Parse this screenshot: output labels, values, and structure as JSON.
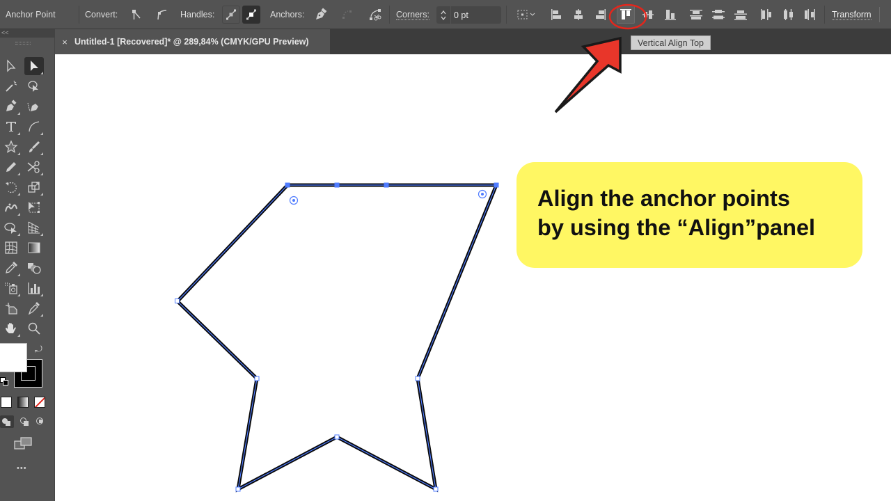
{
  "control_bar": {
    "tool_name": "Anchor Point",
    "convert_label": "Convert:",
    "convert_buttons": [
      {
        "icon": "convert-to-corner-icon",
        "tooltip": "Convert selected anchor points to corner"
      },
      {
        "icon": "convert-to-smooth-icon",
        "tooltip": "Convert selected anchor points to smooth"
      }
    ],
    "handles_label": "Handles:",
    "handles_buttons": [
      {
        "icon": "show-handles-icon",
        "selected": false
      },
      {
        "icon": "hide-handles-icon",
        "selected": true
      }
    ],
    "anchors_label": "Anchors:",
    "anchors_buttons": [
      {
        "icon": "remove-anchor-pen-icon",
        "enabled": true
      },
      {
        "icon": "connect-endpoints-icon",
        "enabled": false
      },
      {
        "icon": "cut-path-at-anchor-icon",
        "enabled": true
      }
    ],
    "corners_label": "Corners:",
    "corners_value": "0 pt",
    "align_to_icon": "align-to-selection-icon",
    "align_buttons": [
      {
        "icon": "horizontal-align-left-icon",
        "tooltip": "Horizontal Align Left"
      },
      {
        "icon": "horizontal-align-center-icon",
        "tooltip": "Horizontal Align Center"
      },
      {
        "icon": "horizontal-align-right-icon",
        "tooltip": "Horizontal Align Right"
      },
      {
        "icon": "vertical-align-top-icon",
        "tooltip": "Vertical Align Top",
        "hovered": true
      },
      {
        "icon": "vertical-align-center-icon",
        "tooltip": "Vertical Align Center"
      },
      {
        "icon": "vertical-align-bottom-icon",
        "tooltip": "Vertical Align Bottom"
      }
    ],
    "distribute_buttons": [
      {
        "icon": "vertical-distribute-top-icon"
      },
      {
        "icon": "vertical-distribute-center-icon"
      },
      {
        "icon": "vertical-distribute-bottom-icon"
      },
      {
        "icon": "horizontal-distribute-left-icon"
      },
      {
        "icon": "horizontal-distribute-center-icon"
      },
      {
        "icon": "horizontal-distribute-right-icon"
      }
    ],
    "transform_label": "Transform"
  },
  "tooltip": {
    "text": "Vertical Align Top"
  },
  "document_tab": {
    "close_glyph": "×",
    "title": "Untitled-1 [Recovered]* @ 289,84% (CMYK/GPU Preview)"
  },
  "toolbar": {
    "collapse_glyph": "<<",
    "tools": [
      {
        "name": "selection-tool",
        "active": false
      },
      {
        "name": "direct-selection-tool",
        "active": true
      },
      {
        "name": "magic-wand-tool"
      },
      {
        "name": "lasso-tool"
      },
      {
        "name": "pen-tool"
      },
      {
        "name": "curvature-pen-tool"
      },
      {
        "name": "type-tool"
      },
      {
        "name": "arc-tool"
      },
      {
        "name": "star-tool"
      },
      {
        "name": "paintbrush-tool"
      },
      {
        "name": "pencil-tool"
      },
      {
        "name": "scissors-tool"
      },
      {
        "name": "rotate-tool"
      },
      {
        "name": "scale-tool"
      },
      {
        "name": "puppet-warp-tool"
      },
      {
        "name": "free-transform-tool"
      },
      {
        "name": "shape-builder-tool"
      },
      {
        "name": "perspective-grid-tool"
      },
      {
        "name": "mesh-tool"
      },
      {
        "name": "gradient-tool"
      },
      {
        "name": "eyedropper-tool"
      },
      {
        "name": "blend-tool"
      },
      {
        "name": "symbol-sprayer-tool"
      },
      {
        "name": "column-graph-tool"
      },
      {
        "name": "artboard-tool"
      },
      {
        "name": "slice-tool"
      },
      {
        "name": "hand-tool"
      },
      {
        "name": "zoom-tool"
      }
    ],
    "fill_color": "#ffffff",
    "stroke_color": "#000000",
    "more_glyph": "•••"
  },
  "canvas": {
    "accent_color": "#4f7cff",
    "stroke_color": "#0a0a0a",
    "arrow_color": "#e8362a",
    "highlight_circle_color": "#e3261c"
  },
  "callout": {
    "line1": "Align the anchor points",
    "line2": "by using the “Align”panel",
    "background": "#fff763"
  }
}
